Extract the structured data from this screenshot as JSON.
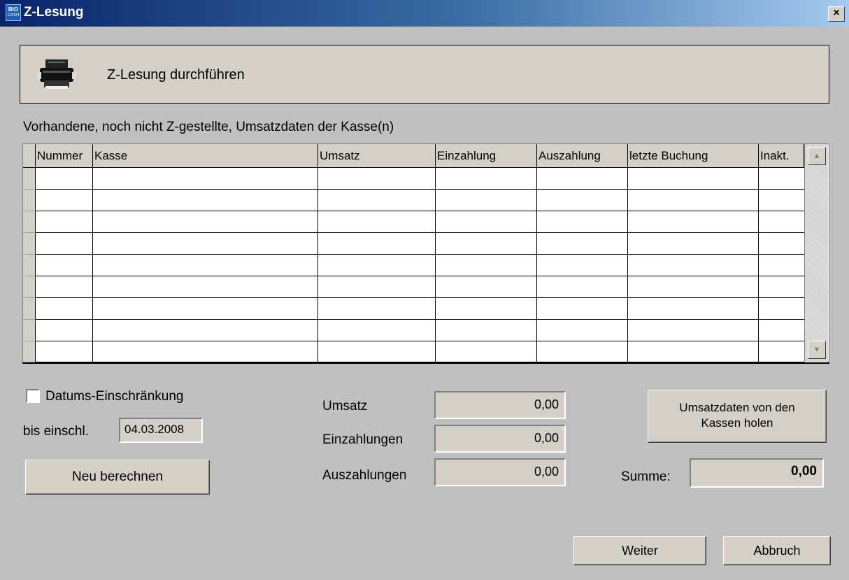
{
  "window": {
    "title": "Z-Lesung",
    "icon_top": "BIO",
    "icon_bottom": "CASH",
    "close_label": "×"
  },
  "header": {
    "icon": "printer-icon",
    "text": "Z-Lesung durchführen"
  },
  "section_label": "Vorhandene, noch nicht Z-gestellte, Umsatzdaten der Kasse(n)",
  "grid": {
    "columns": [
      "Nummer",
      "Kasse",
      "Umsatz",
      "Einzahlung",
      "Auszahlung",
      "letzte Buchung",
      "Inakt."
    ],
    "rows": []
  },
  "filter": {
    "date_restriction_label": "Datums-Einschränkung",
    "date_restriction_checked": false,
    "until_label": "bis einschl.",
    "until_value": "04.03.2008"
  },
  "totals": {
    "umsatz_label": "Umsatz",
    "umsatz_value": "0,00",
    "einzahlungen_label": "Einzahlungen",
    "einzahlungen_value": "0,00",
    "auszahlungen_label": "Auszahlungen",
    "auszahlungen_value": "0,00",
    "summe_label": "Summe:",
    "summe_value": "0,00"
  },
  "buttons": {
    "recalculate": "Neu berechnen",
    "fetch_line1": "Umsatzdaten von den",
    "fetch_line2": "Kassen holen",
    "next": "Weiter",
    "cancel": "Abbruch"
  }
}
